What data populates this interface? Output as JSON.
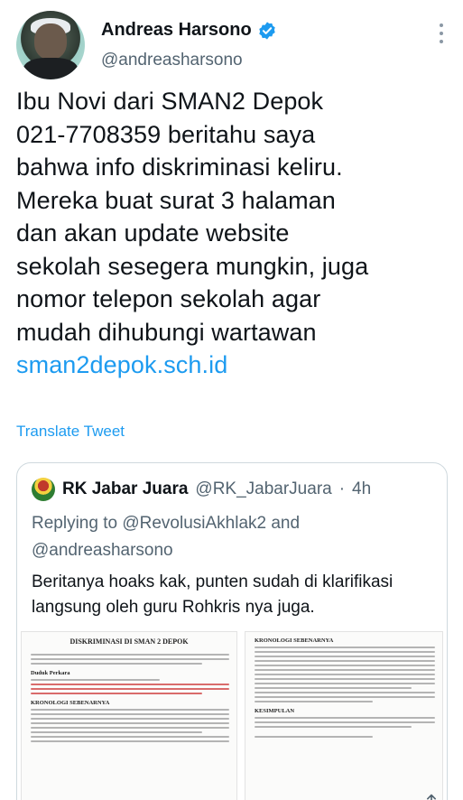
{
  "tweet": {
    "author_name": "Andreas Harsono",
    "author_handle": "@andreasharsono",
    "lines": [
      "Ibu Novi dari SMAN2 Depok",
      "021-7708359 beritahu saya",
      "bahwa info diskriminasi keliru.",
      "Mereka buat surat 3 halaman",
      "dan akan update website",
      "sekolah sesegera mungkin, juga",
      "nomor telepon sekolah agar",
      "mudah dihubungi wartawan"
    ],
    "link": "sman2depok.sch.id",
    "translate_label": "Translate Tweet"
  },
  "quote": {
    "author_name": "RK Jabar Juara",
    "author_handle": "@RK_JabarJuara",
    "separator": "·",
    "time": "4h",
    "replying_lines": [
      "Replying to @RevolusiAkhlak2 and",
      "@andreasharsono"
    ],
    "text_lines": [
      "Beritanya hoaks kak, punten sudah di klarifikasi",
      "langsung oleh guru Rohkris nya juga."
    ],
    "doc_left": {
      "title": "DISKRIMINASI DI SMAN 2 DEPOK",
      "heading1": "Duduk Perkara",
      "heading2": "KRONOLOGI SEBENARNYA"
    },
    "doc_right": {
      "heading1": "KRONOLOGI SEBENARNYA",
      "heading2": "KESIMPULAN"
    }
  },
  "icons": {
    "verified": "verified-badge-icon",
    "more": "more-vertical-icon",
    "share": "share-icon"
  },
  "colors": {
    "link": "#1d9bf0",
    "verified": "#1d9bf0",
    "secondary_text": "#536471",
    "border": "#cfd9de"
  }
}
